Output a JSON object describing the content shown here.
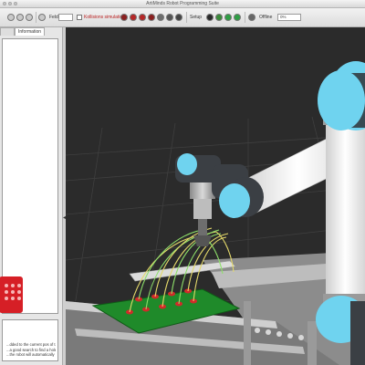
{
  "window": {
    "title": "ArtiMinds Robot Programming Suite"
  },
  "toolbar": {
    "field_label": "Feld",
    "checkbox_label": "Kollisions simulation",
    "setup_label": "Setup",
    "offline_label": "Offline",
    "speed_value": "0%",
    "colors": {
      "red": "#c0392b",
      "green": "#2e9e44",
      "gray": "#666666"
    }
  },
  "left_panel": {
    "tabs": [
      "Information"
    ],
    "info_lines": [
      "...dded to the current pos of t...",
      "...a good search to find a hole. T...",
      "...the robot will automatically m..."
    ]
  },
  "viewport": {
    "colors": {
      "robot_white": "#f0f0f0",
      "robot_joint": "#6fd3ef",
      "pcb": "#1f8a2a",
      "pin": "#d22a2a"
    }
  }
}
